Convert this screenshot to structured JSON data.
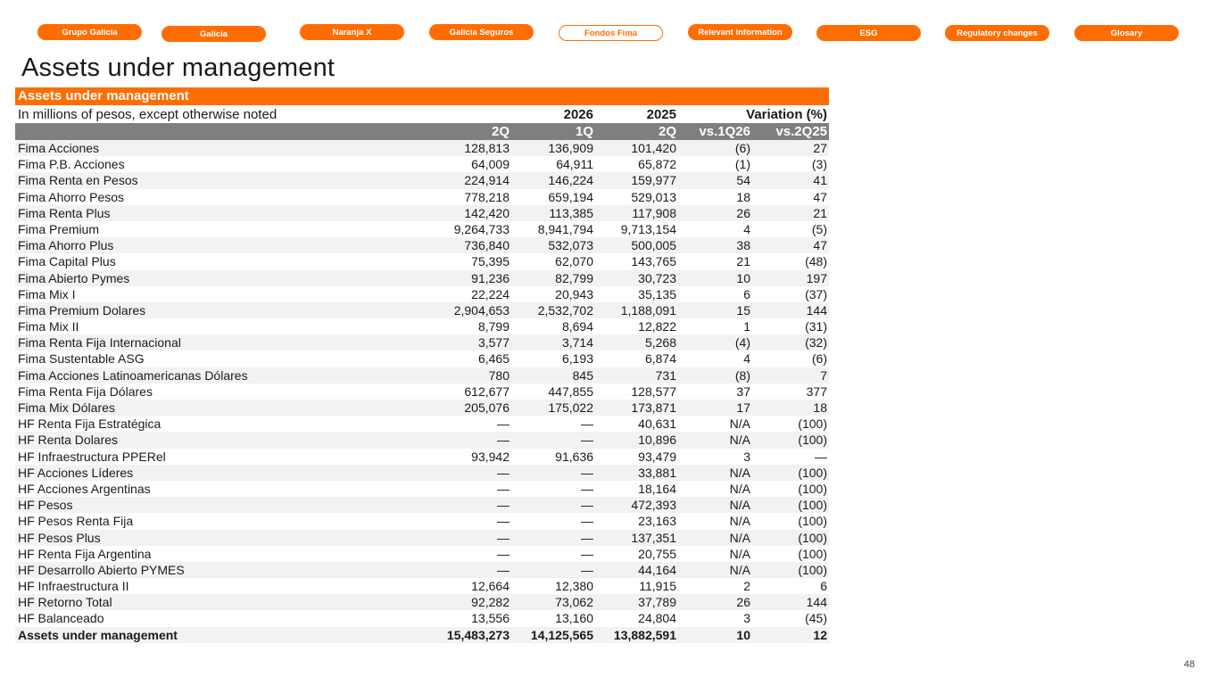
{
  "nav": {
    "tabs": [
      {
        "label": "Grupo Galicia",
        "active": false
      },
      {
        "label": "Galicia",
        "active": false
      },
      {
        "label": "Naranja X",
        "active": false
      },
      {
        "label": "Galicia Seguros",
        "active": false
      },
      {
        "label": "Fondos Fima",
        "active": true
      },
      {
        "label": "Relevant information",
        "active": false
      },
      {
        "label": "ESG",
        "active": false
      },
      {
        "label": "Regulatory changes",
        "active": false
      },
      {
        "label": "Glosary",
        "active": false
      }
    ]
  },
  "page": {
    "title": "Assets under management",
    "number": "48"
  },
  "colors": {
    "accent": "#ff6d00",
    "header_gray": "#7f7f7f",
    "stripe": "#f2f2f2"
  },
  "table": {
    "heading": "Assets under management",
    "subtitle": "In millions of pesos, except otherwise noted",
    "year_2026": "2026",
    "year_2025": "2025",
    "variation_label": "Variation (%)",
    "periods": [
      "2Q",
      "1Q",
      "2Q",
      "vs.1Q26",
      "vs.2Q25"
    ],
    "rows": [
      {
        "name": "Fima Acciones",
        "q2_26": "128,813",
        "q1_26": "136,909",
        "q2_25": "101,420",
        "vs_1q26": "(6)",
        "vs_2q25": "27"
      },
      {
        "name": "Fima P.B. Acciones",
        "q2_26": "64,009",
        "q1_26": "64,911",
        "q2_25": "65,872",
        "vs_1q26": "(1)",
        "vs_2q25": "(3)"
      },
      {
        "name": "Fima Renta en Pesos",
        "q2_26": "224,914",
        "q1_26": "146,224",
        "q2_25": "159,977",
        "vs_1q26": "54",
        "vs_2q25": "41"
      },
      {
        "name": "Fima Ahorro Pesos",
        "q2_26": "778,218",
        "q1_26": "659,194",
        "q2_25": "529,013",
        "vs_1q26": "18",
        "vs_2q25": "47"
      },
      {
        "name": "Fima Renta Plus",
        "q2_26": "142,420",
        "q1_26": "113,385",
        "q2_25": "117,908",
        "vs_1q26": "26",
        "vs_2q25": "21"
      },
      {
        "name": "Fima Premium",
        "q2_26": "9,264,733",
        "q1_26": "8,941,794",
        "q2_25": "9,713,154",
        "vs_1q26": "4",
        "vs_2q25": "(5)"
      },
      {
        "name": "Fima Ahorro Plus",
        "q2_26": "736,840",
        "q1_26": "532,073",
        "q2_25": "500,005",
        "vs_1q26": "38",
        "vs_2q25": "47"
      },
      {
        "name": "Fima Capital Plus",
        "q2_26": "75,395",
        "q1_26": "62,070",
        "q2_25": "143,765",
        "vs_1q26": "21",
        "vs_2q25": "(48)"
      },
      {
        "name": "Fima Abierto Pymes",
        "q2_26": "91,236",
        "q1_26": "82,799",
        "q2_25": "30,723",
        "vs_1q26": "10",
        "vs_2q25": "197"
      },
      {
        "name": "Fima Mix I",
        "q2_26": "22,224",
        "q1_26": "20,943",
        "q2_25": "35,135",
        "vs_1q26": "6",
        "vs_2q25": "(37)"
      },
      {
        "name": "Fima Premium Dolares",
        "q2_26": "2,904,653",
        "q1_26": "2,532,702",
        "q2_25": "1,188,091",
        "vs_1q26": "15",
        "vs_2q25": "144"
      },
      {
        "name": "Fima Mix II",
        "q2_26": "8,799",
        "q1_26": "8,694",
        "q2_25": "12,822",
        "vs_1q26": "1",
        "vs_2q25": "(31)"
      },
      {
        "name": "Fima Renta Fija Internacional",
        "q2_26": "3,577",
        "q1_26": "3,714",
        "q2_25": "5,268",
        "vs_1q26": "(4)",
        "vs_2q25": "(32)"
      },
      {
        "name": "Fima Sustentable ASG",
        "q2_26": "6,465",
        "q1_26": "6,193",
        "q2_25": "6,874",
        "vs_1q26": "4",
        "vs_2q25": "(6)"
      },
      {
        "name": "Fima Acciones Latinoamericanas Dólares",
        "q2_26": "780",
        "q1_26": "845",
        "q2_25": "731",
        "vs_1q26": "(8)",
        "vs_2q25": "7"
      },
      {
        "name": "Fima Renta Fija Dólares",
        "q2_26": "612,677",
        "q1_26": "447,855",
        "q2_25": "128,577",
        "vs_1q26": "37",
        "vs_2q25": "377"
      },
      {
        "name": "Fima Mix Dólares",
        "q2_26": "205,076",
        "q1_26": "175,022",
        "q2_25": "173,871",
        "vs_1q26": "17",
        "vs_2q25": "18"
      },
      {
        "name": "HF Renta Fija Estratégica",
        "q2_26": "—",
        "q1_26": "—",
        "q2_25": "40,631",
        "vs_1q26": "N/A",
        "vs_2q25": "(100)"
      },
      {
        "name": "HF Renta Dolares",
        "q2_26": "—",
        "q1_26": "—",
        "q2_25": "10,896",
        "vs_1q26": "N/A",
        "vs_2q25": "(100)"
      },
      {
        "name": "HF Infraestructura PPERel",
        "q2_26": "93,942",
        "q1_26": "91,636",
        "q2_25": "93,479",
        "vs_1q26": "3",
        "vs_2q25": "—"
      },
      {
        "name": "HF Acciones Líderes",
        "q2_26": "—",
        "q1_26": "—",
        "q2_25": "33,881",
        "vs_1q26": "N/A",
        "vs_2q25": "(100)"
      },
      {
        "name": "HF Acciones Argentinas",
        "q2_26": "—",
        "q1_26": "—",
        "q2_25": "18,164",
        "vs_1q26": "N/A",
        "vs_2q25": "(100)"
      },
      {
        "name": "HF Pesos",
        "q2_26": "—",
        "q1_26": "—",
        "q2_25": "472,393",
        "vs_1q26": "N/A",
        "vs_2q25": "(100)"
      },
      {
        "name": "HF Pesos Renta Fija",
        "q2_26": "—",
        "q1_26": "—",
        "q2_25": "23,163",
        "vs_1q26": "N/A",
        "vs_2q25": "(100)"
      },
      {
        "name": "HF Pesos Plus",
        "q2_26": "—",
        "q1_26": "—",
        "q2_25": "137,351",
        "vs_1q26": "N/A",
        "vs_2q25": "(100)"
      },
      {
        "name": "HF Renta Fija Argentina",
        "q2_26": "—",
        "q1_26": "—",
        "q2_25": "20,755",
        "vs_1q26": "N/A",
        "vs_2q25": "(100)"
      },
      {
        "name": "HF Desarrollo Abierto PYMES",
        "q2_26": "—",
        "q1_26": "—",
        "q2_25": "44,164",
        "vs_1q26": "N/A",
        "vs_2q25": "(100)"
      },
      {
        "name": "HF Infraestructura II",
        "q2_26": "12,664",
        "q1_26": "12,380",
        "q2_25": "11,915",
        "vs_1q26": "2",
        "vs_2q25": "6"
      },
      {
        "name": "HF Retorno Total",
        "q2_26": "92,282",
        "q1_26": "73,062",
        "q2_25": "37,789",
        "vs_1q26": "26",
        "vs_2q25": "144"
      },
      {
        "name": "HF Balanceado",
        "q2_26": "13,556",
        "q1_26": "13,160",
        "q2_25": "24,804",
        "vs_1q26": "3",
        "vs_2q25": "(45)"
      }
    ],
    "total": {
      "name": "Assets under management",
      "q2_26": "15,483,273",
      "q1_26": "14,125,565",
      "q2_25": "13,882,591",
      "vs_1q26": "10",
      "vs_2q25": "12"
    }
  }
}
